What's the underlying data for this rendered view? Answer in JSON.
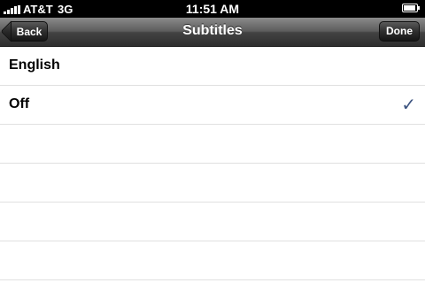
{
  "status_bar": {
    "carrier": "AT&T",
    "network": "3G",
    "time": "11:51 AM"
  },
  "nav": {
    "back_label": "Back",
    "title": "Subtitles",
    "done_label": "Done"
  },
  "options": [
    {
      "label": "English",
      "selected": false
    },
    {
      "label": "Off",
      "selected": true
    }
  ],
  "checkmark_icon": "checkmark-icon",
  "accent_color": "#3d5480"
}
